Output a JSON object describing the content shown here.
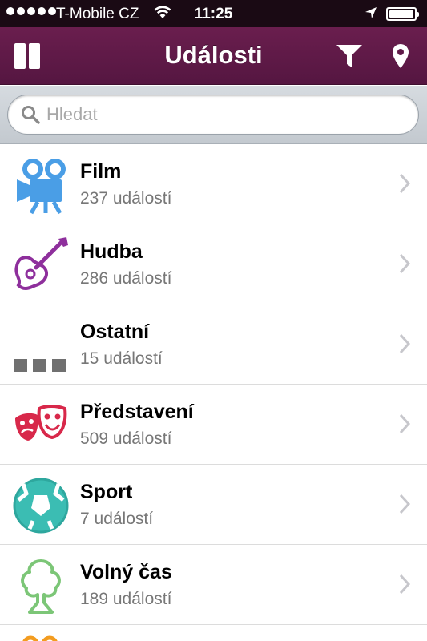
{
  "status_bar": {
    "carrier": "T-Mobile CZ",
    "time": "11:25",
    "signal_bars": 5,
    "battery_level": 1.0
  },
  "nav": {
    "title": "Události",
    "left_icon": "sidebar-menu-icon",
    "right_icons": [
      "filter-icon",
      "location-pin-icon"
    ],
    "accent_color": "#5f1947"
  },
  "search": {
    "placeholder": "Hledat",
    "value": ""
  },
  "categories": [
    {
      "title": "Film",
      "count": "237 událostí",
      "icon": "film-camera-icon",
      "color": "#4a9ee6"
    },
    {
      "title": "Hudba",
      "count": "286 událostí",
      "icon": "guitar-icon",
      "color": "#8e2f9c"
    },
    {
      "title": "Ostatní",
      "count": "15 událostí",
      "icon": "three-squares-icon",
      "color": "#707070"
    },
    {
      "title": "Představení",
      "count": "509 událostí",
      "icon": "theater-masks-icon",
      "color": "#d8284a"
    },
    {
      "title": "Sport",
      "count": "7 událostí",
      "icon": "soccer-ball-icon",
      "color": "#3bbdb3"
    },
    {
      "title": "Volný čas",
      "count": "189 událostí",
      "icon": "tree-icon",
      "color": "#7cc677"
    }
  ],
  "partial_row_icon_color": "#f39c1f"
}
